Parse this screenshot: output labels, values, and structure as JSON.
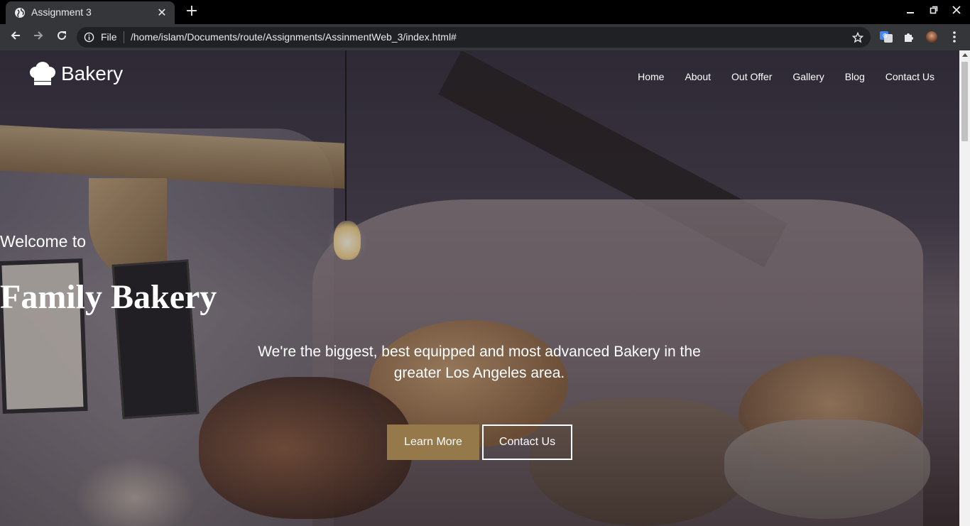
{
  "browser": {
    "tab_title": "Assignment 3",
    "tab_close": "✕",
    "new_tab": "+",
    "omnibox_scheme": "File",
    "url": "/home/islam/Documents/route/Assignments/AssinmentWeb_3/index.html#",
    "icons": {
      "favicon": "globe-icon",
      "back": "back-arrow-icon",
      "forward": "forward-arrow-icon",
      "reload": "reload-icon",
      "info": "info-icon",
      "star": "bookmark-star-icon",
      "translate": "translate-icon",
      "extensions": "puzzle-icon",
      "profile": "avatar",
      "menu": "kebab-menu-icon"
    }
  },
  "site": {
    "logo_text": "Bakery",
    "nav": [
      {
        "label": "Home"
      },
      {
        "label": "About"
      },
      {
        "label": "Out Offer"
      },
      {
        "label": "Gallery"
      },
      {
        "label": "Blog"
      },
      {
        "label": "Contact Us"
      }
    ]
  },
  "hero": {
    "welcome": "Welcome to",
    "title": "Family Bakery",
    "subtitle": "We're the biggest, best equipped and most advanced Bakery in the greater Los Angeles area.",
    "learn_more": "Learn More",
    "contact_us": "Contact Us"
  },
  "colors": {
    "accent_button": "#96794a",
    "chrome_dark": "#35363a",
    "omnibox": "#202124"
  }
}
